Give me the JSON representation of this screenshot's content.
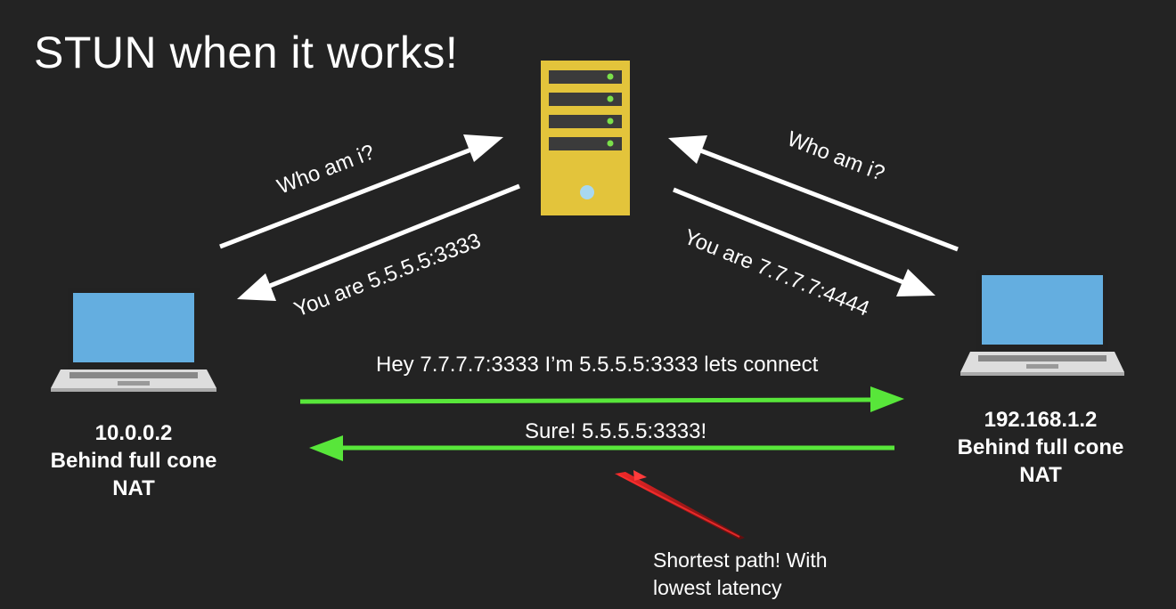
{
  "title": "STUN when it works!",
  "server": {
    "icon": "server-icon",
    "color": "#e3c43b"
  },
  "left_host": {
    "icon": "laptop-icon",
    "ip": "10.0.0.2",
    "line2": "Behind full cone",
    "line3": "NAT"
  },
  "right_host": {
    "icon": "laptop-icon",
    "ip": "192.168.1.2",
    "line2": "Behind full cone",
    "line3": "NAT"
  },
  "arrows": {
    "left_to_server": "Who am i?",
    "server_to_left": "You are 5.5.5.5:3333",
    "right_to_server": "Who am i?",
    "server_to_right": "You are 7.7.7.7:4444",
    "left_to_right": "Hey 7.7.7.7:3333 I’m 5.5.5.5:3333 lets connect",
    "right_to_left": "Sure! 5.5.5.5:3333!"
  },
  "annotation": {
    "line1": "Shortest path! With",
    "line2": "lowest latency",
    "color": "#ff2020"
  },
  "colors": {
    "background": "#232323",
    "p2p_arrow": "#58e63a",
    "server_arrow": "#ffffff",
    "laptop_screen": "#64aee0"
  }
}
